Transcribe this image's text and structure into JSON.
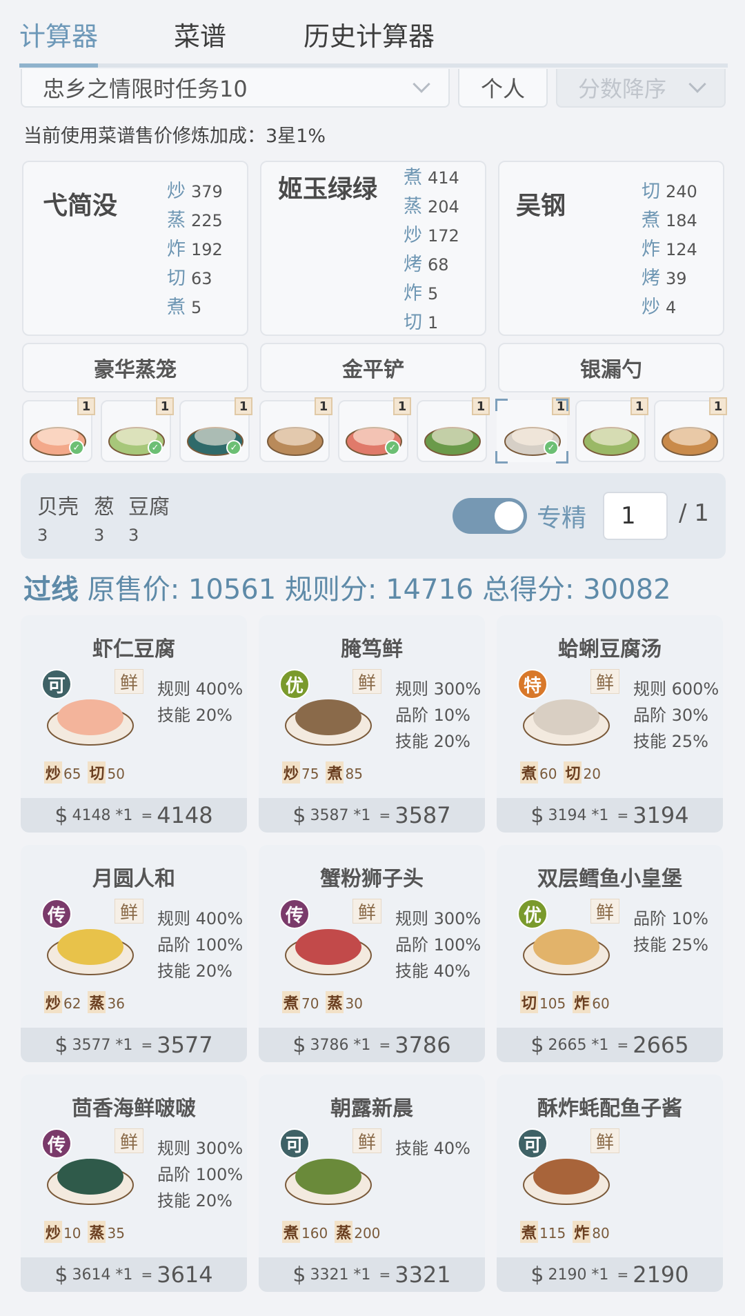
{
  "tabs": [
    "计算器",
    "菜谱",
    "历史计算器"
  ],
  "filters": {
    "task": "忠乡之情限时任务10",
    "mode": "个人",
    "sort": "分数降序"
  },
  "info_line": "当前使用菜谱售价修炼加成：3星1%",
  "chefs": [
    {
      "name": "弋简没",
      "skills": [
        {
          "k": "炒",
          "v": "379"
        },
        {
          "k": "蒸",
          "v": "225"
        },
        {
          "k": "炸",
          "v": "192"
        },
        {
          "k": "切",
          "v": "63"
        },
        {
          "k": "煮",
          "v": "5"
        }
      ]
    },
    {
      "name": "姬玉绿绿",
      "skills": [
        {
          "k": "煮",
          "v": "414"
        },
        {
          "k": "蒸",
          "v": "204"
        },
        {
          "k": "炒",
          "v": "172"
        },
        {
          "k": "烤",
          "v": "68"
        },
        {
          "k": "炸",
          "v": "5"
        },
        {
          "k": "切",
          "v": "1"
        }
      ]
    },
    {
      "name": "吴钢",
      "skills": [
        {
          "k": "切",
          "v": "240"
        },
        {
          "k": "煮",
          "v": "184"
        },
        {
          "k": "炸",
          "v": "124"
        },
        {
          "k": "烤",
          "v": "39"
        },
        {
          "k": "炒",
          "v": "4"
        }
      ]
    }
  ],
  "equipment": [
    "豪华蒸笼",
    "金平铲",
    "银漏勺"
  ],
  "thumbs": [
    {
      "badge": "1",
      "checked": true
    },
    {
      "badge": "1",
      "checked": true
    },
    {
      "badge": "1",
      "checked": true
    },
    {
      "badge": "1",
      "checked": false
    },
    {
      "badge": "1",
      "checked": true
    },
    {
      "badge": "1",
      "checked": false
    },
    {
      "badge": "1",
      "checked": true
    },
    {
      "badge": "1",
      "checked": false
    },
    {
      "badge": "1",
      "checked": false
    }
  ],
  "ingredients": [
    {
      "name": "贝壳",
      "qty": "3"
    },
    {
      "name": "葱",
      "qty": "3"
    },
    {
      "name": "豆腐",
      "qty": "3"
    }
  ],
  "toggle_label": "专精",
  "page_input": "1",
  "page_total": "/ 1",
  "score": {
    "pass": "过线",
    "original_label": "原售价:",
    "original_value": "10561",
    "rule_label": "规则分:",
    "rule_value": "14716",
    "total_label": "总得分:",
    "total_value": "30082"
  },
  "dishes": [
    {
      "title": "虾仁豆腐",
      "grade": "可",
      "grade_color": "#3f6266",
      "fresh": "鲜",
      "rules": [
        "规则 400%",
        "技能 20%"
      ],
      "skills": [
        {
          "k": "炒",
          "v": "65"
        },
        {
          "k": "切",
          "v": "50"
        }
      ],
      "base": "4148 *1",
      "total": "4148",
      "img": "#f3b49b"
    },
    {
      "title": "腌笃鲜",
      "grade": "优",
      "grade_color": "#7a9a2c",
      "fresh": "鲜",
      "rules": [
        "规则 300%",
        "品阶 10%",
        "技能 20%"
      ],
      "skills": [
        {
          "k": "炒",
          "v": "75"
        },
        {
          "k": "煮",
          "v": "85"
        }
      ],
      "base": "3587 *1",
      "total": "3587",
      "img": "#8a6a4a"
    },
    {
      "title": "蛤蜊豆腐汤",
      "grade": "特",
      "grade_color": "#d8782a",
      "fresh": "鲜",
      "rules": [
        "规则 600%",
        "品阶 30%",
        "技能 25%"
      ],
      "skills": [
        {
          "k": "煮",
          "v": "60"
        },
        {
          "k": "切",
          "v": "20"
        }
      ],
      "base": "3194 *1",
      "total": "3194",
      "img": "#d9cfc3"
    },
    {
      "title": "月圆人和",
      "grade": "传",
      "grade_color": "#7a3a6a",
      "fresh": "鲜",
      "rules": [
        "规则 400%",
        "品阶 100%",
        "技能 20%"
      ],
      "skills": [
        {
          "k": "炒",
          "v": "62"
        },
        {
          "k": "蒸",
          "v": "36"
        }
      ],
      "base": "3577 *1",
      "total": "3577",
      "img": "#e8c24a"
    },
    {
      "title": "蟹粉狮子头",
      "grade": "传",
      "grade_color": "#7a3a6a",
      "fresh": "鲜",
      "rules": [
        "规则 300%",
        "品阶 100%",
        "技能 40%"
      ],
      "skills": [
        {
          "k": "煮",
          "v": "70"
        },
        {
          "k": "蒸",
          "v": "30"
        }
      ],
      "base": "3786 *1",
      "total": "3786",
      "img": "#c24a4a"
    },
    {
      "title": "双层鳕鱼小皇堡",
      "grade": "优",
      "grade_color": "#7a9a2c",
      "fresh": "鲜",
      "rules": [
        "品阶 10%",
        "技能 25%"
      ],
      "skills": [
        {
          "k": "切",
          "v": "105"
        },
        {
          "k": "炸",
          "v": "60"
        }
      ],
      "base": "2665 *1",
      "total": "2665",
      "img": "#e2b36a"
    },
    {
      "title": "茴香海鲜啵啵",
      "grade": "传",
      "grade_color": "#7a3a6a",
      "fresh": "鲜",
      "rules": [
        "规则 300%",
        "品阶 100%",
        "技能 20%"
      ],
      "skills": [
        {
          "k": "炒",
          "v": "10"
        },
        {
          "k": "蒸",
          "v": "35"
        }
      ],
      "base": "3614 *1",
      "total": "3614",
      "img": "#2f5a4a"
    },
    {
      "title": "朝露新晨",
      "grade": "可",
      "grade_color": "#3f6266",
      "fresh": "鲜",
      "rules": [
        "技能 40%"
      ],
      "skills": [
        {
          "k": "煮",
          "v": "160"
        },
        {
          "k": "蒸",
          "v": "200"
        }
      ],
      "base": "3321 *1",
      "total": "3321",
      "img": "#6a8a3a"
    },
    {
      "title": "酥炸蚝配鱼子酱",
      "grade": "可",
      "grade_color": "#3f6266",
      "fresh": "鲜",
      "rules": [],
      "skills": [
        {
          "k": "煮",
          "v": "115"
        },
        {
          "k": "炸",
          "v": "80"
        }
      ],
      "base": "2190 *1",
      "total": "2190",
      "img": "#a8643a"
    }
  ]
}
